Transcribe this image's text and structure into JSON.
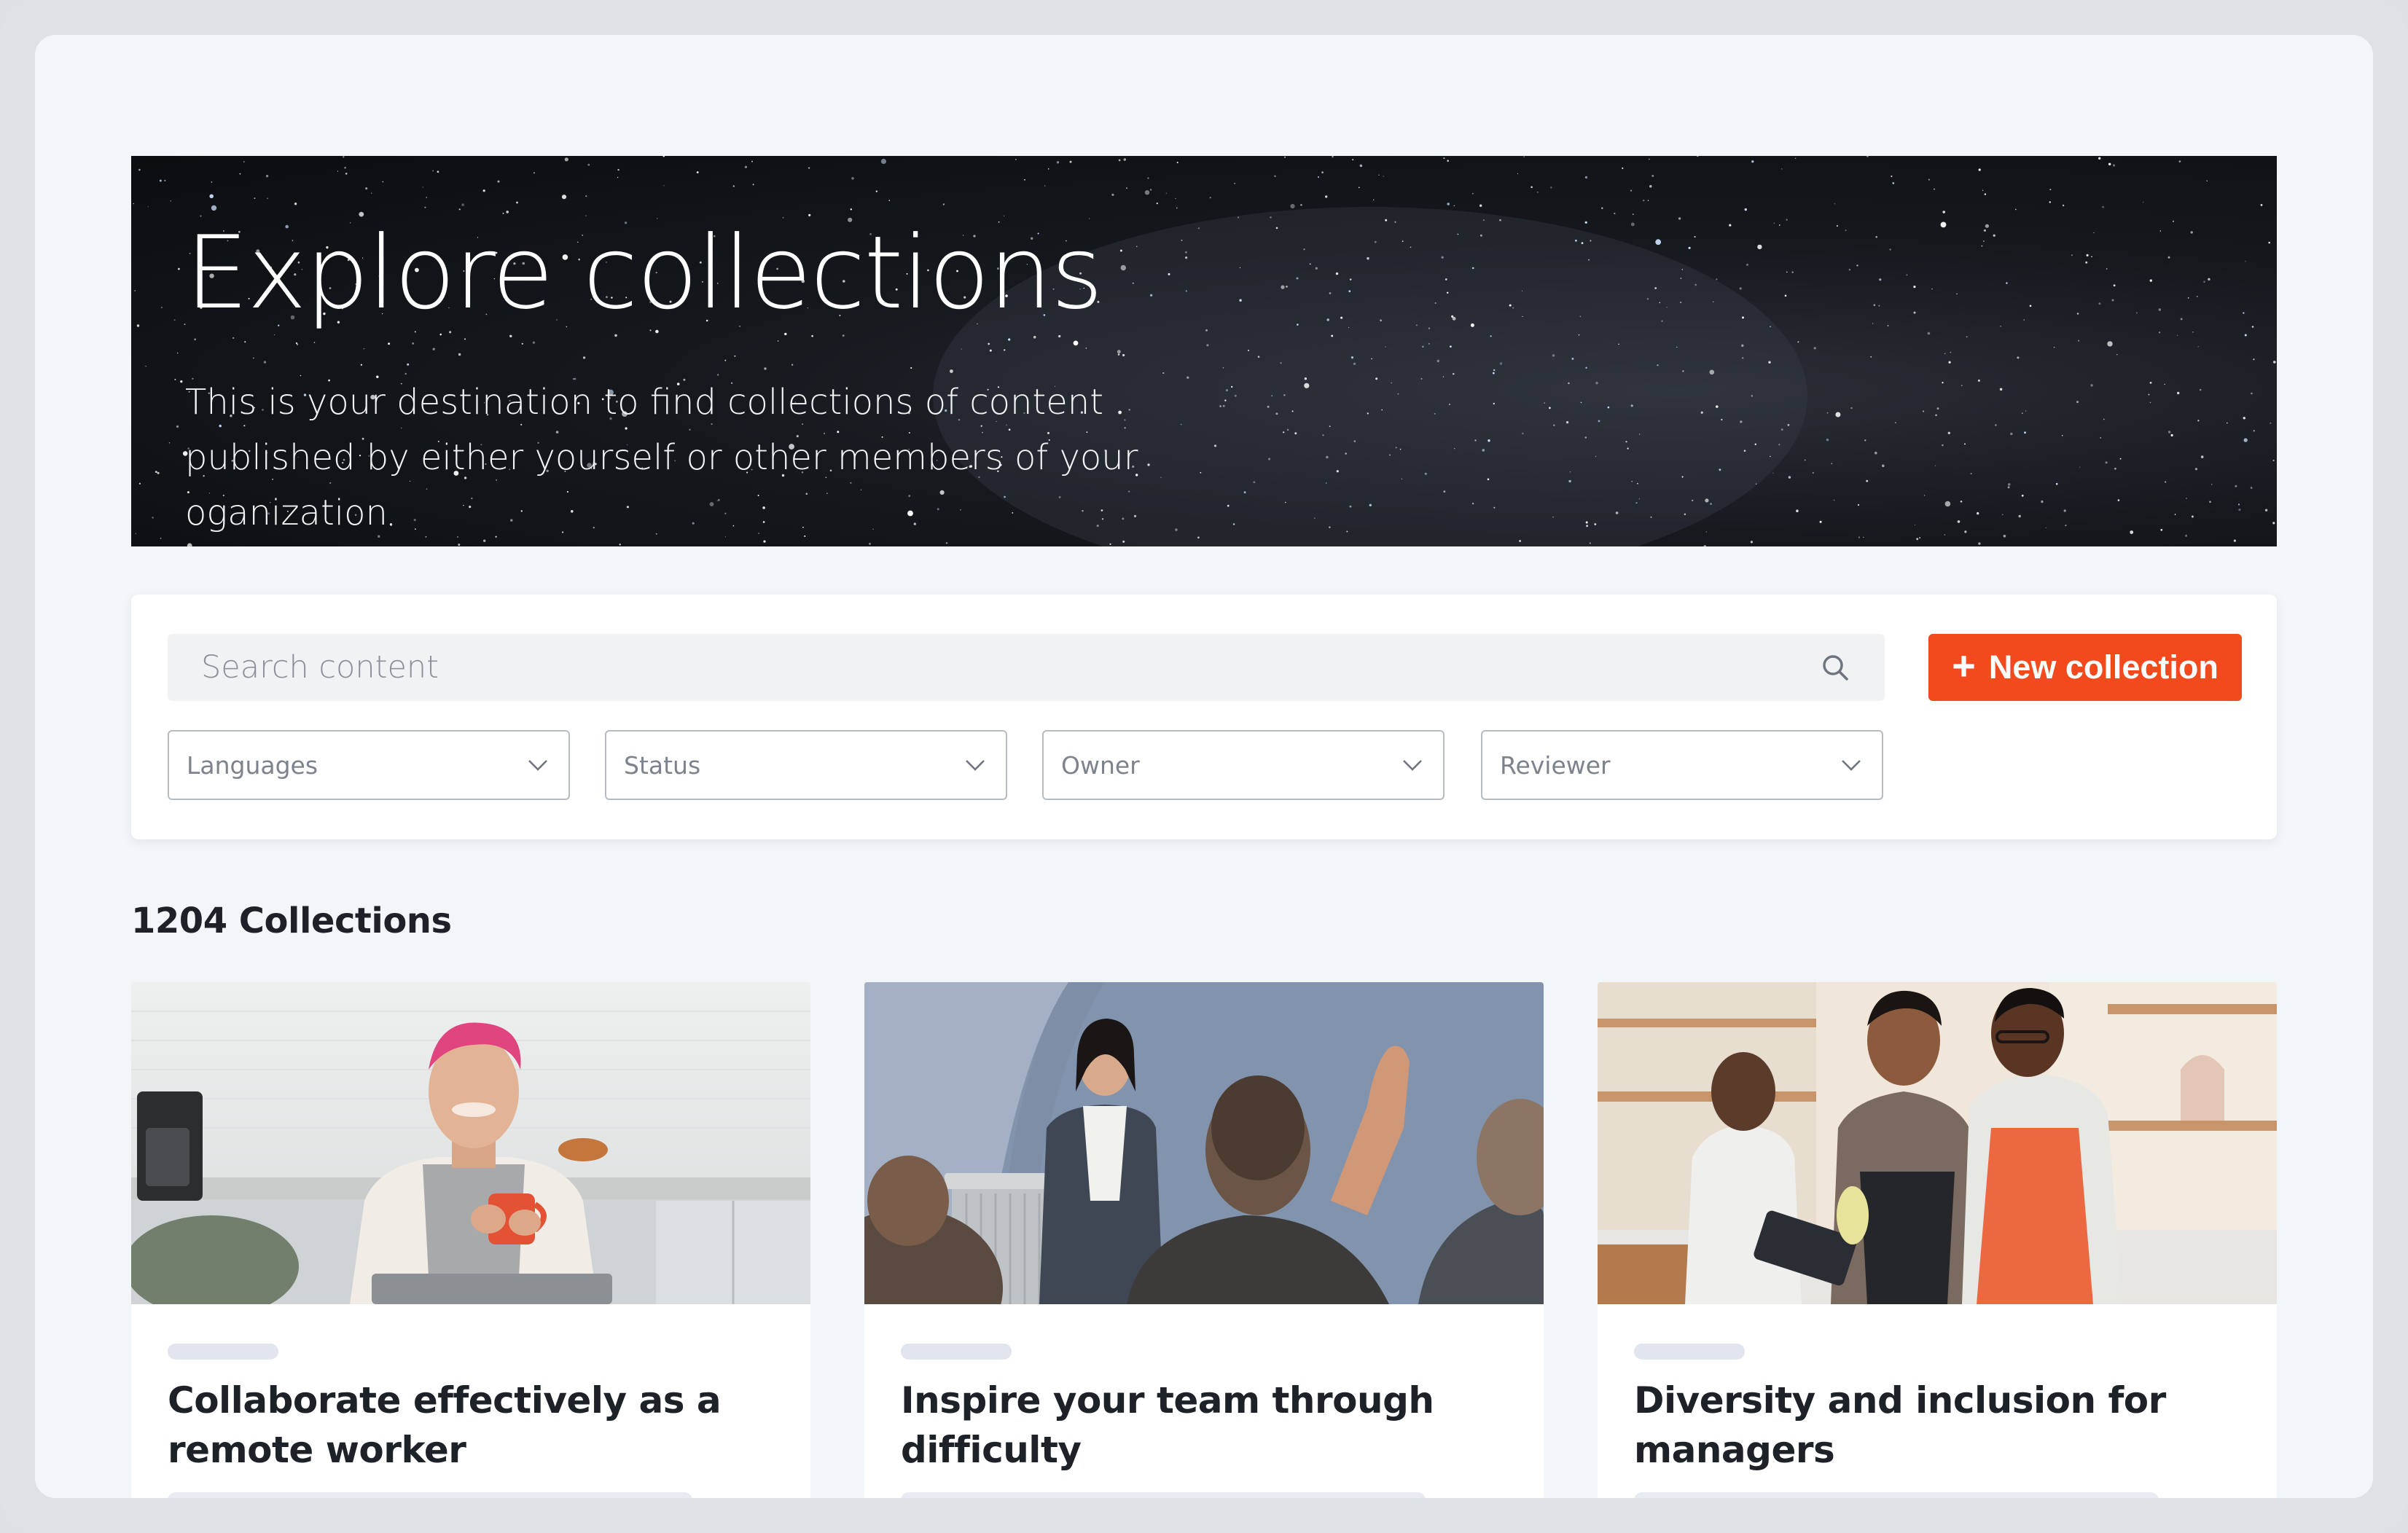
{
  "hero": {
    "title": "Explore collections",
    "description": "This is your destination to find collections of content published by either yourself or other members of your oganization"
  },
  "search": {
    "placeholder": "Search content",
    "icon": "search-icon"
  },
  "actions": {
    "new_collection_icon": "+",
    "new_collection_label": "New collection",
    "accent_color": "#f24a1d"
  },
  "filters": [
    {
      "label": "Languages"
    },
    {
      "label": "Status"
    },
    {
      "label": "Owner"
    },
    {
      "label": "Reviewer"
    }
  ],
  "results": {
    "count_label": "1204 Collections"
  },
  "cards": [
    {
      "title": "Collaborate effectively as a remote worker",
      "image": "woman-with-mug-in-kitchen"
    },
    {
      "title": "Inspire your team through difficulty",
      "image": "presenter-at-podium"
    },
    {
      "title": "Diversity and inclusion for managers",
      "image": "people-cooking-in-kitchen"
    }
  ]
}
